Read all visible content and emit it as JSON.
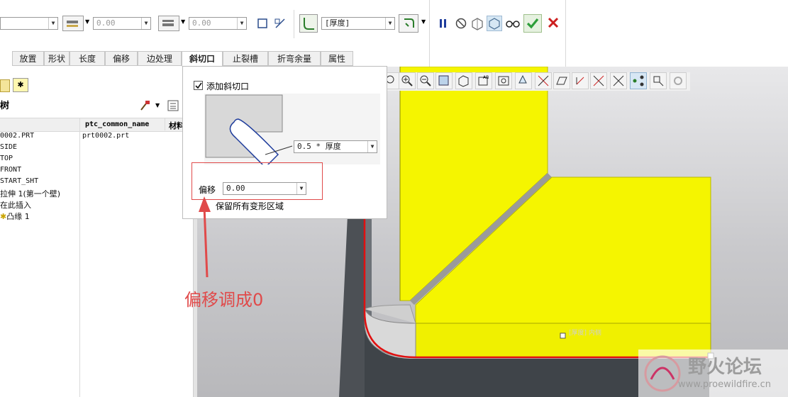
{
  "dashboard": {
    "left_combo_value": "",
    "thickness_combo1": "0.00",
    "thickness_combo2": "0.00",
    "ref_combo": "[厚度]",
    "pause_icon": "pause-icon",
    "stop_icon": "no-entry-icon",
    "preview1_icon": "geometry-preview-icon",
    "preview2_icon": "feature-preview-icon",
    "glasses_icon": "verify-glasses-icon",
    "ok_icon": "checkmark-icon",
    "cancel_icon": "x-cancel-icon",
    "ok_color": "#2e9e3a",
    "cancel_color": "#cc1f1f"
  },
  "tabs": [
    {
      "label": "放置"
    },
    {
      "label": "形状"
    },
    {
      "label": "长度"
    },
    {
      "label": "偏移"
    },
    {
      "label": "边处理"
    },
    {
      "label": "斜切口"
    },
    {
      "label": "止裂槽"
    },
    {
      "label": "折弯余量"
    },
    {
      "label": "属性"
    }
  ],
  "tree": {
    "title": "树",
    "col1": "ptc_common_name",
    "col2": "材料",
    "rows": [
      {
        "name": "0002.PRT",
        "common": "prt0002.prt"
      },
      {
        "name": "SIDE",
        "common": ""
      },
      {
        "name": "TOP",
        "common": ""
      },
      {
        "name": "FRONT",
        "common": ""
      },
      {
        "name": "START_SHT",
        "common": ""
      },
      {
        "name": "拉伸 1(第一个壁)",
        "common": ""
      },
      {
        "name": "在此插入",
        "common": ""
      },
      {
        "name": "凸缘 1",
        "common": ""
      }
    ]
  },
  "panel": {
    "add_miter_checked": true,
    "add_miter_label": "添加斜切口",
    "width_value": "0.5 * 厚度",
    "offset_label": "偏移",
    "offset_value": "0.00",
    "keep_label": "保留所有变形区域"
  },
  "viewport": {
    "label": "[厚度] 内侧"
  },
  "annotation": {
    "text": "偏移调成0",
    "color": "#e04a4a"
  },
  "watermark": {
    "title": "野火论坛",
    "url": "www.proewildfire.cn"
  }
}
